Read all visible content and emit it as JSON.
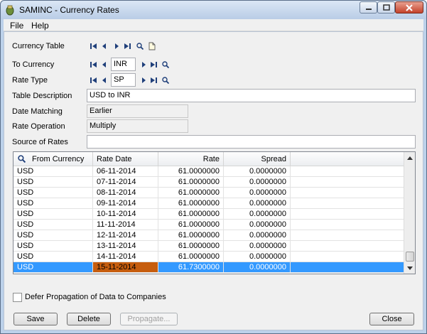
{
  "window": {
    "title": "SAMINC - Currency Rates"
  },
  "menu": [
    {
      "label": "File"
    },
    {
      "label": "Help"
    }
  ],
  "form": {
    "currency_table_label": "Currency Table",
    "to_currency_label": "To Currency",
    "to_currency_value": "INR",
    "rate_type_label": "Rate Type",
    "rate_type_value": "SP",
    "table_description_label": "Table Description",
    "table_description_value": "USD to INR",
    "date_matching_label": "Date Matching",
    "date_matching_value": "Earlier",
    "rate_operation_label": "Rate Operation",
    "rate_operation_value": "Multiply",
    "source_of_rates_label": "Source of Rates",
    "source_of_rates_value": ""
  },
  "grid": {
    "headers": [
      "From Currency",
      "Rate Date",
      "Rate",
      "Spread"
    ],
    "rows": [
      [
        "USD",
        "06-11-2014",
        "61.0000000",
        "0.0000000"
      ],
      [
        "USD",
        "07-11-2014",
        "61.0000000",
        "0.0000000"
      ],
      [
        "USD",
        "08-11-2014",
        "61.0000000",
        "0.0000000"
      ],
      [
        "USD",
        "09-11-2014",
        "61.0000000",
        "0.0000000"
      ],
      [
        "USD",
        "10-11-2014",
        "61.0000000",
        "0.0000000"
      ],
      [
        "USD",
        "11-11-2014",
        "61.0000000",
        "0.0000000"
      ],
      [
        "USD",
        "12-11-2014",
        "61.0000000",
        "0.0000000"
      ],
      [
        "USD",
        "13-11-2014",
        "61.0000000",
        "0.0000000"
      ],
      [
        "USD",
        "14-11-2014",
        "61.0000000",
        "0.0000000"
      ],
      [
        "USD",
        "15-11-2014",
        "61.7300000",
        "0.0000000"
      ]
    ],
    "selected_row": 9
  },
  "defer_propagation": {
    "label": "Defer Propagation of Data to Companies",
    "checked": false
  },
  "buttons": {
    "save": "Save",
    "delete": "Delete",
    "propagate": "Propagate...",
    "close": "Close"
  }
}
